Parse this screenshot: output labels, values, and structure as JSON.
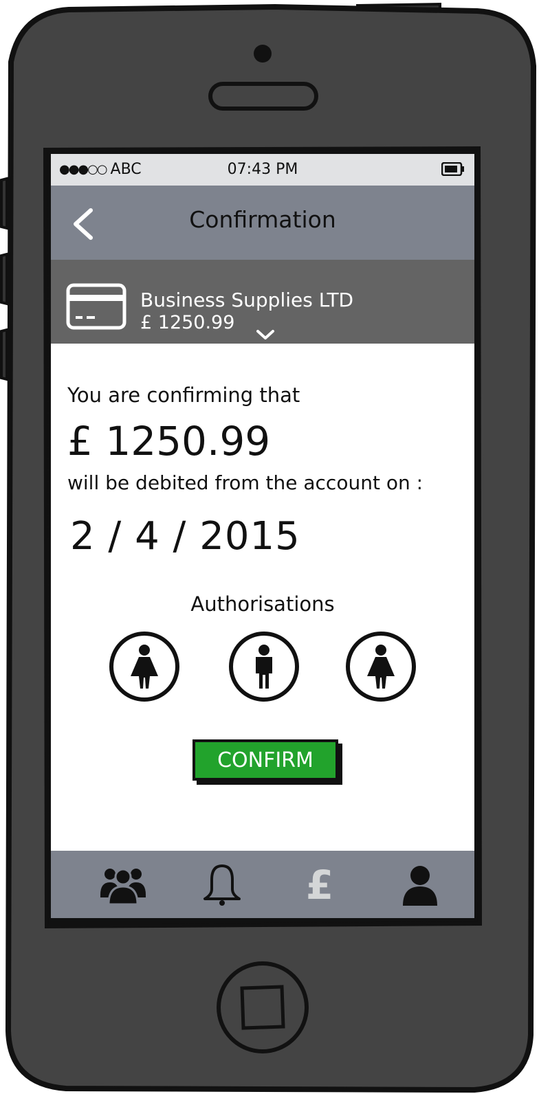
{
  "status_bar": {
    "signal": "●●●○○",
    "carrier": "ABC",
    "time": "07:43 PM"
  },
  "nav": {
    "title": "Confirmation"
  },
  "account": {
    "name": "Business Supplies LTD",
    "amount": "£ 1250.99"
  },
  "confirmation": {
    "lead_text": "You are confirming that",
    "amount": "£ 1250.99",
    "debit_text": "will be debited from the account on :",
    "date": "2 / 4 / 2015"
  },
  "authorisations": {
    "label": "Authorisations",
    "people": [
      "female-person-icon",
      "male-person-icon",
      "female-person-icon"
    ]
  },
  "confirm_button": {
    "label": "CONFIRM"
  },
  "tabs": [
    {
      "icon": "people-icon"
    },
    {
      "icon": "bell-icon"
    },
    {
      "icon": "pound-icon",
      "glyph": "£",
      "active": true
    },
    {
      "icon": "user-icon"
    }
  ],
  "colors": {
    "phone_body": "#444444",
    "nav_bar": "#7e838e",
    "account_header": "#646464",
    "status_bar": "#e1e2e4",
    "confirm_green": "#22a32c",
    "active_tab": "#d4d6d7"
  }
}
